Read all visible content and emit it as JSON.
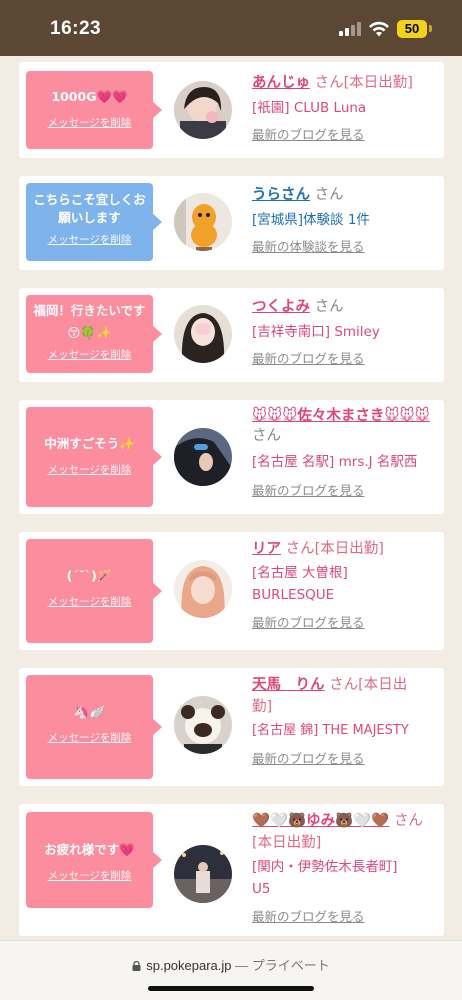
{
  "status_bar": {
    "time": "16:23",
    "battery": "50"
  },
  "browser": {
    "url": "sp.pokepara.jp",
    "separator": " — ",
    "mode": "プライベート"
  },
  "delete_label": "メッセージを削除",
  "honorific": "さん",
  "messages": [
    {
      "bubble": "1000G💗💗",
      "bubble_color": "#fb8d9e",
      "name": "あんじゅ",
      "name_suffix": "さん[本日出勤]",
      "shop": "[祇園] CLUB Luna",
      "link": "最新のブログを見る",
      "avatar": "photo-woman-peace-sign"
    },
    {
      "bubble": "こちらこそ宜しくお願いします",
      "bubble_color": "#7eb3ec",
      "name": "うらさん",
      "name_suffix": "さん",
      "shop": "[宮城県]体験談 1件",
      "link": "最新の体験談を見る",
      "avatar": "photo-orange-mascot"
    },
    {
      "bubble": "福岡！行きたいです😚🍀✨",
      "bubble_color": "#fb8d9e",
      "name": "つくよみ",
      "name_suffix": "さん",
      "shop": "[吉祥寺南口] Smiley",
      "link": "最新のブログを見る",
      "avatar": "photo-woman-dark-hair"
    },
    {
      "bubble": "中洲すごそう✨",
      "bubble_color": "#fb8d9e",
      "name": "🐭🐭🐭佐々木まさき🐭🐭🐭",
      "name_suffix": "さん",
      "shop": "[名古屋 名駅] mrs.J 名駅西",
      "link": "最新のブログを見る",
      "avatar": "photo-hair-clip"
    },
    {
      "bubble": "(´˘`)🪄",
      "bubble_color": "#fb8d9e",
      "name": "リア",
      "name_suffix": "さん[本日出勤]",
      "shop": "[名古屋 大曽根] BURLESQUE",
      "link": "最新のブログを見る",
      "avatar": "photo-woman-blonde"
    },
    {
      "bubble": "🦄🪽",
      "bubble_color": "#fb8d9e",
      "name": "天馬　りん",
      "name_suffix": "さん[本日出勤]",
      "shop": "[名古屋 錦] THE MAJESTY",
      "link": "最新のブログを見る",
      "avatar": "photo-plush-bear"
    },
    {
      "bubble": "お疲れ様です💗",
      "bubble_color": "#fb8d9e",
      "name": "🤎🤍🐻ゆみ🐻🤍🤎",
      "name_suffix": "さん[本日出勤]",
      "shop": "[関内・伊勢佐木長者町] U5",
      "link": "最新のブログを見る",
      "avatar": "photo-street-night"
    }
  ]
}
